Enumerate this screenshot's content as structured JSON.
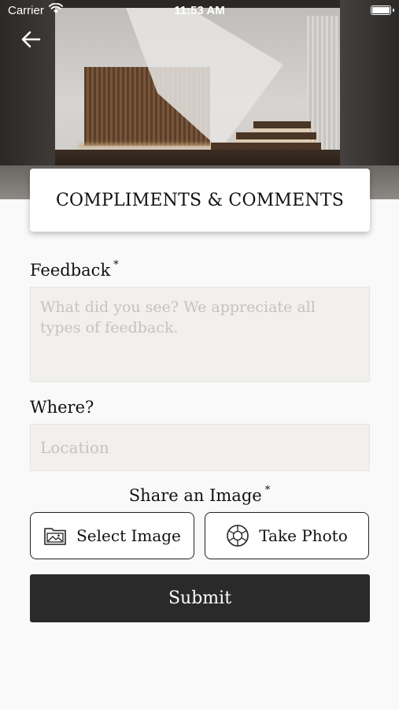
{
  "status_bar": {
    "carrier": "Carrier",
    "time": "11:53 AM"
  },
  "header": {
    "title": "COMPLIMENTS & COMMENTS",
    "back_icon": "arrow-left-icon"
  },
  "form": {
    "feedback": {
      "label": "Feedback",
      "required_mark": "*",
      "value": "",
      "placeholder": "What did you see? We appreciate all types of feedback."
    },
    "where": {
      "label": "Where?",
      "value": "",
      "placeholder": "Location"
    },
    "share_image": {
      "label": "Share an Image",
      "required_mark": "*",
      "select_label": "Select Image",
      "select_icon": "image-folder-icon",
      "take_label": "Take Photo",
      "take_icon": "camera-aperture-icon"
    },
    "submit_label": "Submit"
  },
  "colors": {
    "submit_bg": "#2a2a2a",
    "input_bg": "#f1f0ee",
    "page_bg": "#f9f9f9"
  }
}
